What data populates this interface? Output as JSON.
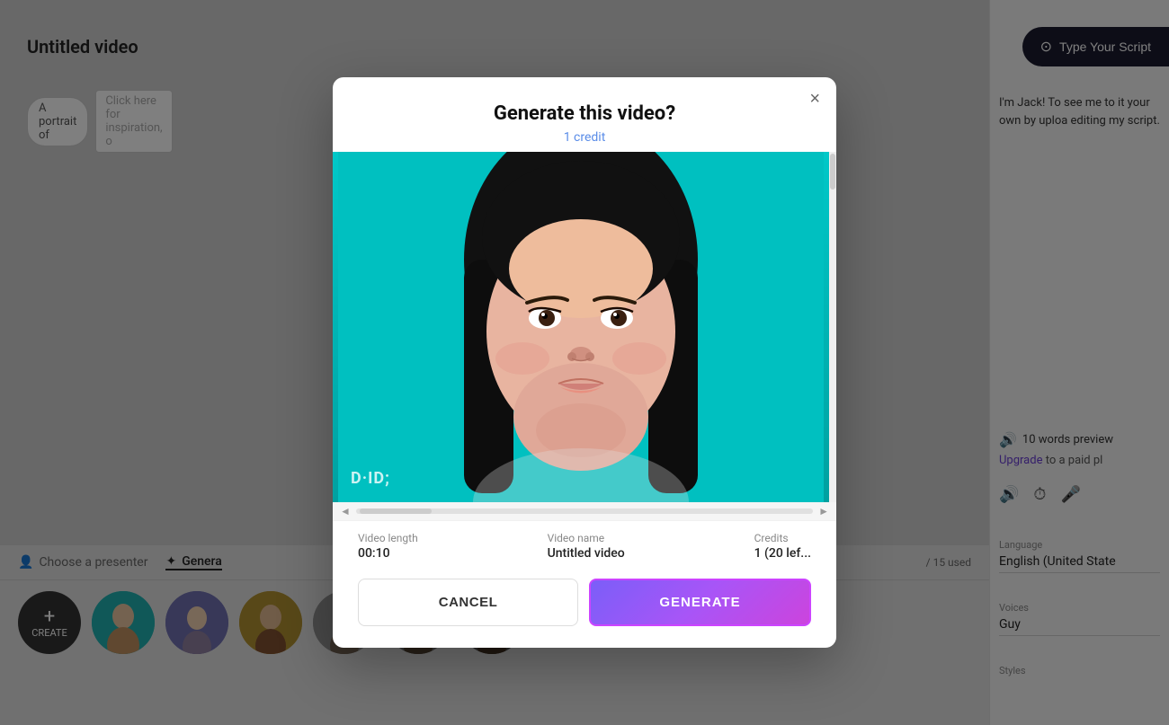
{
  "page": {
    "title": "Untitled video"
  },
  "topbar": {
    "tag": "A portrait of",
    "placeholder": "Click here for inspiration, o"
  },
  "right_panel": {
    "script_button_label": "Type Your Script",
    "preview_text": "I'm Jack! To see me to it your own by uploa editing my script.",
    "words_preview": "10 words preview",
    "upgrade_label": "Upgrade",
    "upgrade_suffix": "to a paid pl",
    "language_label": "Language",
    "language_value": "English (United State",
    "voices_label": "Voices",
    "voices_value": "Guy",
    "styles_label": "Styles"
  },
  "presenter_tabs": [
    {
      "label": "Choose a presenter",
      "active": false
    },
    {
      "label": "Genera",
      "active": true
    }
  ],
  "used_counter": "/ 15 used",
  "modal": {
    "title": "Generate this video?",
    "credit_label": "1 credit",
    "close_label": "×",
    "video_length_label": "Video length",
    "video_length_value": "00:10",
    "video_name_label": "Video name",
    "video_name_value": "Untitled video",
    "credits_label": "Credits",
    "credits_value": "1 (20 lef...",
    "cancel_label": "CANCEL",
    "generate_label": "GENERATE"
  },
  "avatars": [
    {
      "id": "create",
      "label": "CREATE"
    },
    {
      "id": "av1",
      "color": "#20b0b0"
    },
    {
      "id": "av2",
      "color": "#8080c0"
    },
    {
      "id": "av3",
      "color": "#c0a040"
    },
    {
      "id": "av4",
      "color": "#a0a0a0"
    },
    {
      "id": "av5",
      "color": "#808080"
    },
    {
      "id": "av6",
      "color": "#606060"
    }
  ]
}
